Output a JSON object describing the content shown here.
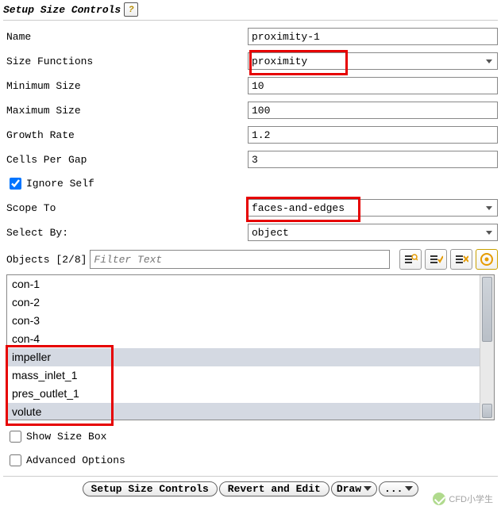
{
  "header": {
    "title": "Setup Size Controls"
  },
  "form": {
    "name_label": "Name",
    "name_value": "proximity-1",
    "size_functions_label": "Size Functions",
    "size_functions_value": "proximity",
    "min_size_label": "Minimum Size",
    "min_size_value": "10",
    "max_size_label": "Maximum Size",
    "max_size_value": "100",
    "growth_rate_label": "Growth Rate",
    "growth_rate_value": "1.2",
    "cells_per_gap_label": "Cells Per Gap",
    "cells_per_gap_value": "3",
    "ignore_self_label": "Ignore Self",
    "scope_to_label": "Scope To",
    "scope_to_value": "faces-and-edges",
    "select_by_label": "Select By:",
    "select_by_value": "object"
  },
  "objects": {
    "heading": "Objects [2/8]",
    "filter_placeholder": "Filter Text",
    "items": [
      {
        "label": "con-1",
        "selected": false
      },
      {
        "label": "con-2",
        "selected": false
      },
      {
        "label": "con-3",
        "selected": false
      },
      {
        "label": "con-4",
        "selected": false
      },
      {
        "label": "impeller",
        "selected": true
      },
      {
        "label": "mass_inlet_1",
        "selected": false
      },
      {
        "label": "pres_outlet_1",
        "selected": false
      },
      {
        "label": "volute",
        "selected": true
      }
    ]
  },
  "footer": {
    "show_size_box_label": "Show Size Box",
    "advanced_options_label": "Advanced Options"
  },
  "buttons": {
    "setup": "Setup Size Controls",
    "revert": "Revert and Edit",
    "draw": "Draw",
    "more": "..."
  },
  "watermark": {
    "text": "CFD小学生"
  }
}
